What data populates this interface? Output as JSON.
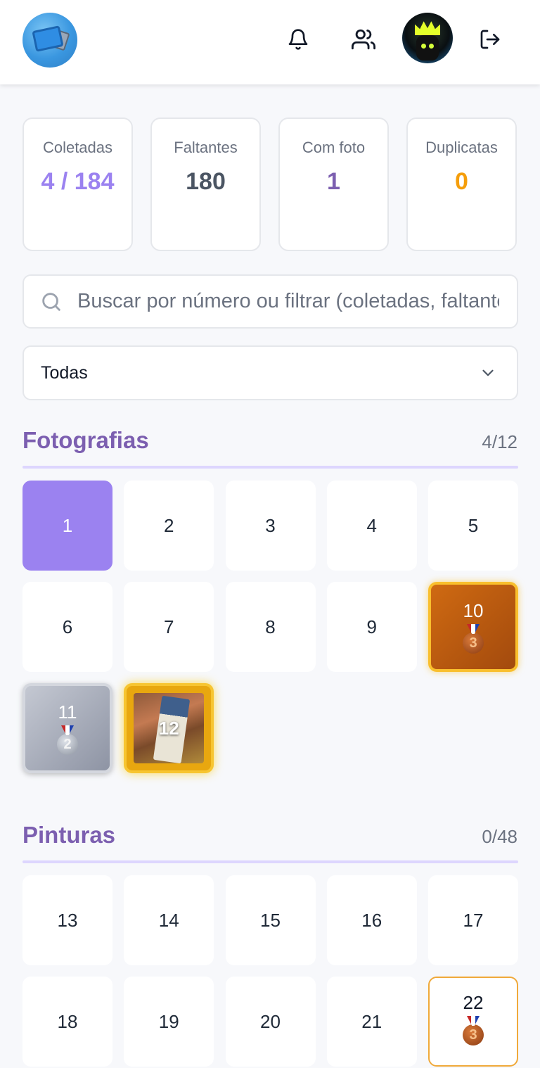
{
  "header": {
    "icons": [
      "bell-icon",
      "users-icon",
      "logout-icon"
    ]
  },
  "stats": [
    {
      "label": "Coletadas",
      "value": "4 / 184",
      "color": "#9b82f0"
    },
    {
      "label": "Faltantes",
      "value": "180",
      "color": "#4b5563"
    },
    {
      "label": "Com foto",
      "value": "1",
      "color": "#7c5fb0"
    },
    {
      "label": "Duplicatas",
      "value": "0",
      "color": "#f59e0b"
    }
  ],
  "search": {
    "placeholder": "Buscar por número ou filtrar (coletadas, faltantes, duplicatas)"
  },
  "filter": {
    "selected": "Todas"
  },
  "sections": [
    {
      "title": "Fotografias",
      "count": "4/12",
      "items": [
        {
          "number": "1",
          "state": "collected"
        },
        {
          "number": "2",
          "state": "empty"
        },
        {
          "number": "3",
          "state": "empty"
        },
        {
          "number": "4",
          "state": "empty"
        },
        {
          "number": "5",
          "state": "empty"
        },
        {
          "number": "6",
          "state": "empty"
        },
        {
          "number": "7",
          "state": "empty"
        },
        {
          "number": "8",
          "state": "empty"
        },
        {
          "number": "9",
          "state": "empty"
        },
        {
          "number": "10",
          "state": "bronze",
          "medal": "3"
        },
        {
          "number": "11",
          "state": "silver",
          "medal": "2"
        },
        {
          "number": "12",
          "state": "photo"
        }
      ]
    },
    {
      "title": "Pinturas",
      "count": "0/48",
      "items": [
        {
          "number": "13",
          "state": "empty"
        },
        {
          "number": "14",
          "state": "empty"
        },
        {
          "number": "15",
          "state": "empty"
        },
        {
          "number": "16",
          "state": "empty"
        },
        {
          "number": "17",
          "state": "empty"
        },
        {
          "number": "18",
          "state": "empty"
        },
        {
          "number": "19",
          "state": "empty"
        },
        {
          "number": "20",
          "state": "empty"
        },
        {
          "number": "21",
          "state": "empty"
        },
        {
          "number": "22",
          "state": "outline",
          "medal": "3"
        }
      ]
    }
  ]
}
